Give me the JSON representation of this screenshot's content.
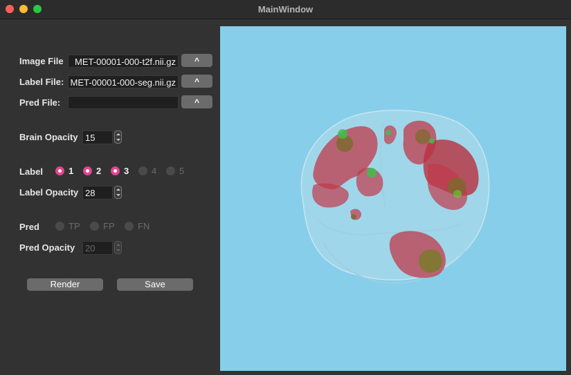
{
  "window": {
    "title": "MainWindow"
  },
  "files": {
    "image_label": "Image File",
    "image_value": "MET-00001-000-t2f.nii.gz",
    "label_label": "Label File:",
    "label_value": "MET-00001-000-seg.nii.gz",
    "pred_label": "Pred File:",
    "pred_value": "",
    "browse_label": "^"
  },
  "brain": {
    "opacity_label": "Brain Opacity",
    "opacity_value": "15"
  },
  "label": {
    "title": "Label",
    "options": [
      {
        "text": "1",
        "checked": true,
        "enabled": true
      },
      {
        "text": "2",
        "checked": true,
        "enabled": true
      },
      {
        "text": "3",
        "checked": true,
        "enabled": true
      },
      {
        "text": "4",
        "checked": false,
        "enabled": false
      },
      {
        "text": "5",
        "checked": false,
        "enabled": false
      }
    ],
    "opacity_label": "Label Opacity",
    "opacity_value": "28"
  },
  "pred": {
    "title": "Pred",
    "options": [
      {
        "text": "TP",
        "checked": false,
        "enabled": false
      },
      {
        "text": "FP",
        "checked": false,
        "enabled": false
      },
      {
        "text": "FN",
        "checked": false,
        "enabled": false
      }
    ],
    "opacity_label": "Pred Opacity",
    "opacity_value": "20"
  },
  "actions": {
    "render_label": "Render",
    "save_label": "Save"
  },
  "colors": {
    "viewport_bg": "#87ceeb",
    "lesion": "#c0394a",
    "core": "#6a8f2a",
    "accent": "#e0458f"
  }
}
